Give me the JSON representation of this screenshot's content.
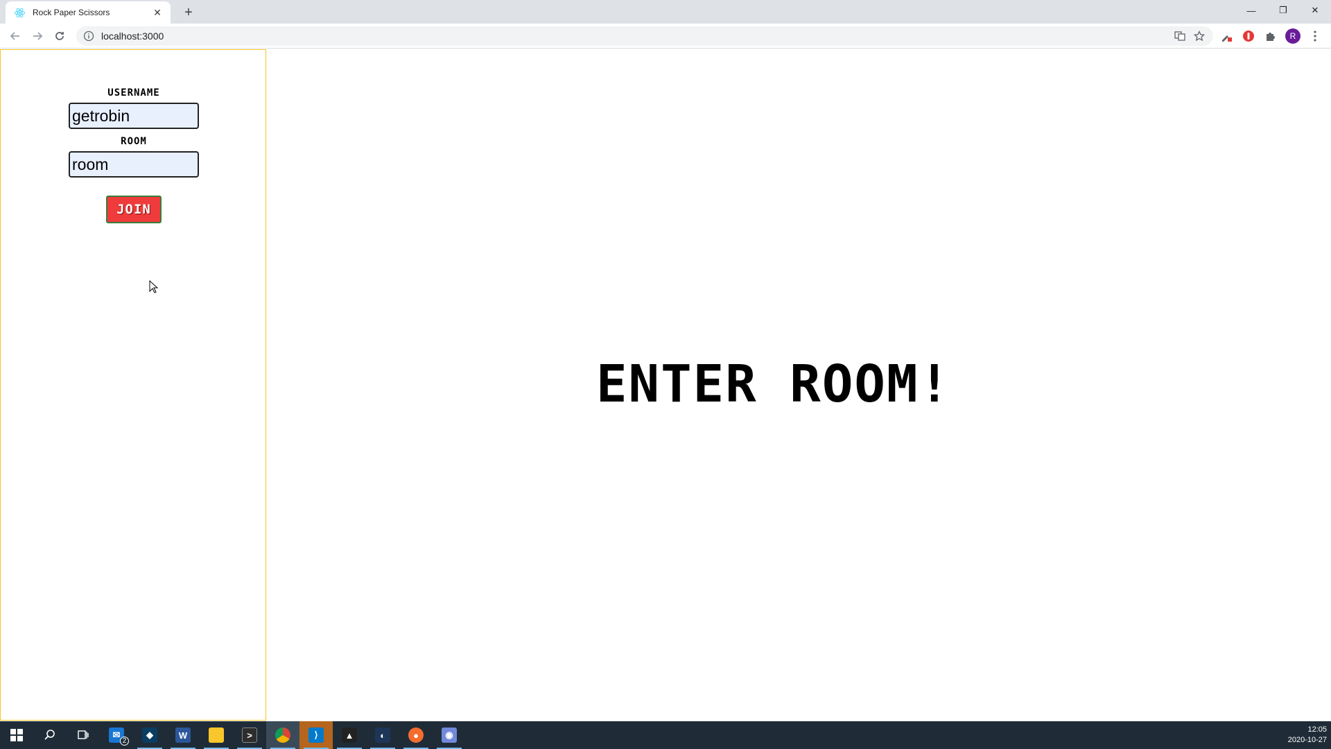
{
  "browser": {
    "tab_title": "Rock Paper Scissors",
    "tab_close": "✕",
    "new_tab": "+",
    "url": "localhost:3000",
    "window_controls": {
      "minimize": "—",
      "restore": "❐",
      "close": "✕"
    },
    "avatar_letter": "R"
  },
  "form": {
    "username_label": "USERNAME",
    "username_value": "getrobin",
    "room_label": "ROOM",
    "room_value": "room",
    "join_label": "JOIN"
  },
  "main": {
    "headline": "ENTER ROOM!"
  },
  "taskbar": {
    "mail_badge": "2",
    "time": "12:05",
    "date": "2020-10-27"
  },
  "colors": {
    "sidebar_border": "#f3c623",
    "join_button": "#ef3b3b",
    "input_bg": "#e8f0fe",
    "taskbar": "#1f2c38"
  }
}
